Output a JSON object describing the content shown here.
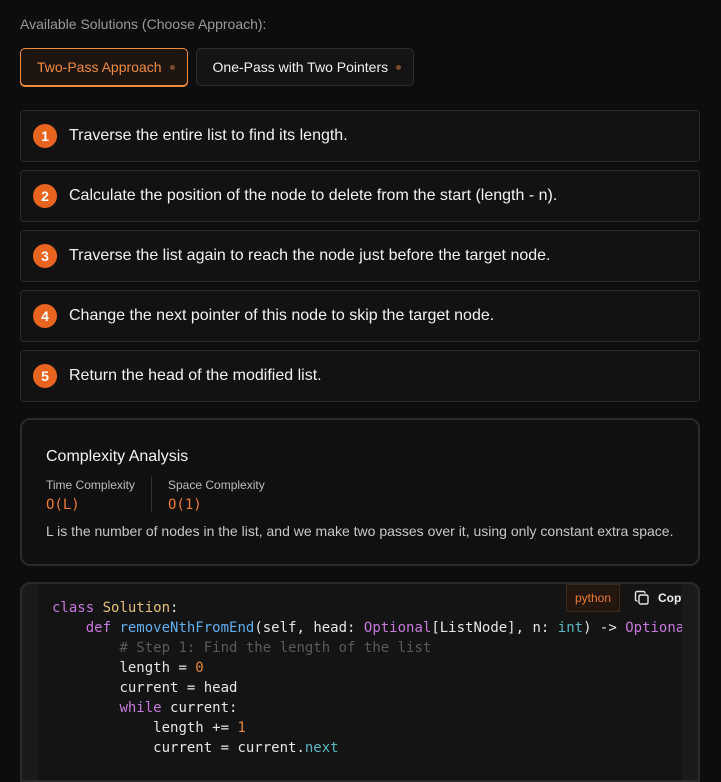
{
  "section_label": "Available Solutions (Choose Approach):",
  "tabs": [
    {
      "label": "Two-Pass Approach",
      "active": true
    },
    {
      "label": "One-Pass with Two Pointers",
      "active": false
    }
  ],
  "steps": [
    {
      "num": "1",
      "text": "Traverse the entire list to find its length."
    },
    {
      "num": "2",
      "text": "Calculate the position of the node to delete from the start (length - n)."
    },
    {
      "num": "3",
      "text": "Traverse the list again to reach the node just before the target node."
    },
    {
      "num": "4",
      "text": "Change the next pointer of this node to skip the target node."
    },
    {
      "num": "5",
      "text": "Return the head of the modified list."
    }
  ],
  "complexity": {
    "title": "Complexity Analysis",
    "time_label": "Time Complexity",
    "time_value": "O(L)",
    "space_label": "Space Complexity",
    "space_value": "O(1)",
    "note": "L is the number of nodes in the list, and we make two passes over it, using only constant extra space."
  },
  "code": {
    "language": "python",
    "copy_label": "Copy",
    "line1": {
      "kw": "class",
      "name": "Solution",
      "rest": ":"
    },
    "line2": {
      "kw": "def",
      "fn": "removeNthFromEnd",
      "p1": "(self, head: ",
      "t1": "Optional",
      "p2": "[ListNode], n: ",
      "t2": "int",
      "p3": ") -> ",
      "t3": "Optiona"
    },
    "line3": {
      "comment": "# Step 1: Find the length of the list"
    },
    "line4": {
      "var": "length = ",
      "num": "0"
    },
    "line5": {
      "text": "current = head"
    },
    "line6": {
      "kw": "while",
      "rest": " current:"
    },
    "line7": {
      "var": "length += ",
      "num": "1"
    },
    "line8": {
      "var": "current = current.",
      "attr": "next"
    }
  },
  "colors": {
    "accent": "#e8641f",
    "background": "#0d0d0d"
  }
}
